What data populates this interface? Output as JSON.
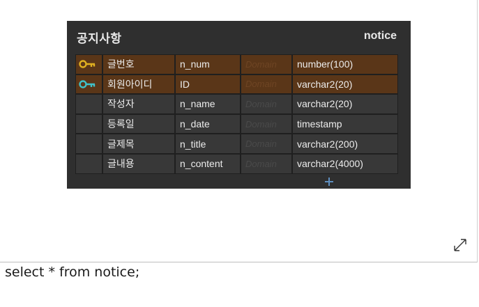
{
  "entity": {
    "logical_name": "공지사항",
    "physical_name": "notice",
    "domain_placeholder": "Domain",
    "columns": [
      {
        "key": "gold-key-icon",
        "logical": "글번호",
        "physical": "n_num",
        "domain": "Domain",
        "type": "number(100)",
        "pk": true
      },
      {
        "key": "teal-key-icon",
        "logical": "회원아이디",
        "physical": "ID",
        "domain": "Domain",
        "type": "varchar2(20)",
        "pk": true
      },
      {
        "key": "",
        "logical": "작성자",
        "physical": "n_name",
        "domain": "Domain",
        "type": "varchar2(20)",
        "pk": false
      },
      {
        "key": "",
        "logical": "등록일",
        "physical": "n_date",
        "domain": "Domain",
        "type": "timestamp",
        "pk": false
      },
      {
        "key": "",
        "logical": "글제목",
        "physical": "n_title",
        "domain": "Domain",
        "type": "varchar2(200)",
        "pk": false
      },
      {
        "key": "",
        "logical": "글내용",
        "physical": "n_content",
        "domain": "Domain",
        "type": "varchar2(4000)",
        "pk": false
      }
    ],
    "add_column_icon": "plus-icon"
  },
  "colors": {
    "entity_bg": "#2f2f2f",
    "pk_row": "#5a3618",
    "row": "#383838",
    "gold_key": "#e0b020",
    "teal_key": "#3fc1c9",
    "plus": "#5f8fc0"
  },
  "expand_icon": "expand-arrows-icon",
  "query": "select * from notice;"
}
